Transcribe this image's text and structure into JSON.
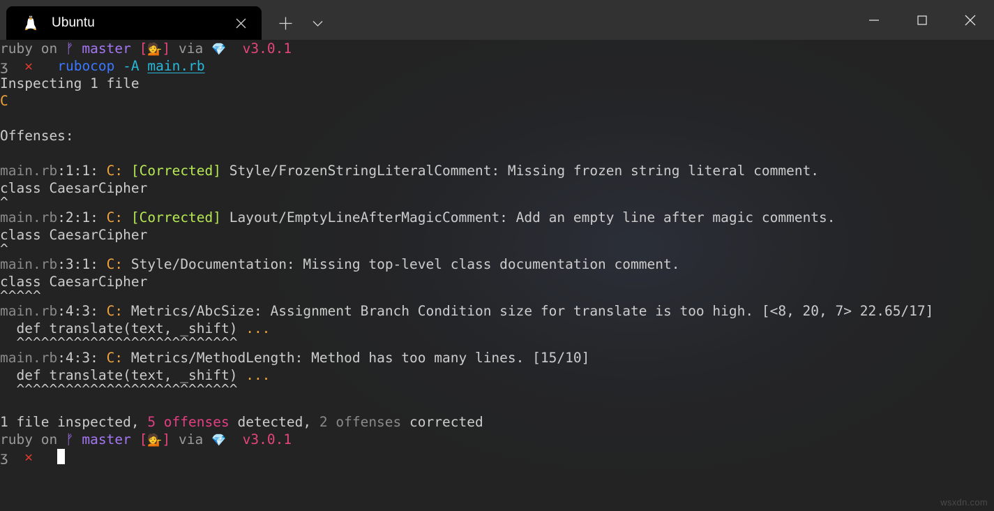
{
  "window": {
    "tab": {
      "title": "Ubuntu",
      "icon": "ubuntu-tux-icon",
      "close_label": "✕"
    },
    "new_tab_label": "+",
    "dropdown_label": "⌄",
    "controls": {
      "minimize_label": "—",
      "maximize_label": "□",
      "close_label": "✕"
    }
  },
  "colors": {
    "accent_orange": "#f0a33c",
    "accent_green": "#b5e853",
    "accent_pink": "#e5457d",
    "accent_purple": "#a477f2",
    "accent_blue": "#3b78ff",
    "accent_cyan": "#29b8db",
    "accent_red": "#e13b2f",
    "terminal_bg": "#232323",
    "titlebar_bg": "#323232",
    "tab_bg": "#000000",
    "foreground": "#cccccc"
  },
  "prompt": {
    "lang": "ruby",
    "on": "on",
    "branch_glyph": "ᚠ",
    "branch": "master",
    "bracket_open": "[",
    "status_emoji": "💁",
    "bracket_close": "]",
    "via": "via",
    "gem_emoji": "💎",
    "version": "v3.0.1",
    "char_glyph": "ʒ",
    "fail_glyph": "✕"
  },
  "command": {
    "program": "rubocop",
    "flag": "-A",
    "file": "main.rb"
  },
  "output": {
    "inspecting": "Inspecting 1 file",
    "progress": "C",
    "offenses_header": "Offenses:",
    "offenses": [
      {
        "file": "main.rb",
        "loc": ":1:1:",
        "severity": "C:",
        "corrected": "[Corrected]",
        "message": "Style/FrozenStringLiteralComment: Missing frozen string literal comment.",
        "source": "class CaesarCipher",
        "source_suffix": "",
        "marker": "^"
      },
      {
        "file": "main.rb",
        "loc": ":2:1:",
        "severity": "C:",
        "corrected": "[Corrected]",
        "message": "Layout/EmptyLineAfterMagicComment: Add an empty line after magic comments.",
        "source": "class CaesarCipher",
        "source_suffix": "",
        "marker": "^"
      },
      {
        "file": "main.rb",
        "loc": ":3:1:",
        "severity": "C:",
        "corrected": "",
        "message": "Style/Documentation: Missing top-level class documentation comment.",
        "source": "class CaesarCipher",
        "source_suffix": "",
        "marker": "^^^^^"
      },
      {
        "file": "main.rb",
        "loc": ":4:3:",
        "severity": "C:",
        "corrected": "",
        "message": "Metrics/AbcSize: Assignment Branch Condition size for translate is too high. [<8, 20, 7> 22.65/17]",
        "source": "  def translate(text, _shift) ",
        "source_suffix": "...",
        "marker": "  ^^^^^^^^^^^^^^^^^^^^^^^^^^^"
      },
      {
        "file": "main.rb",
        "loc": ":4:3:",
        "severity": "C:",
        "corrected": "",
        "message": "Metrics/MethodLength: Method has too many lines. [15/10]",
        "source": "  def translate(text, _shift) ",
        "source_suffix": "...",
        "marker": "  ^^^^^^^^^^^^^^^^^^^^^^^^^^^"
      }
    ],
    "summary": {
      "part1": "1 file inspected, ",
      "count_detected": "5 offenses",
      "part2": " detected, ",
      "count_corrected": "2 offenses",
      "part3": " corrected"
    }
  },
  "watermark": "wsxdn.com"
}
